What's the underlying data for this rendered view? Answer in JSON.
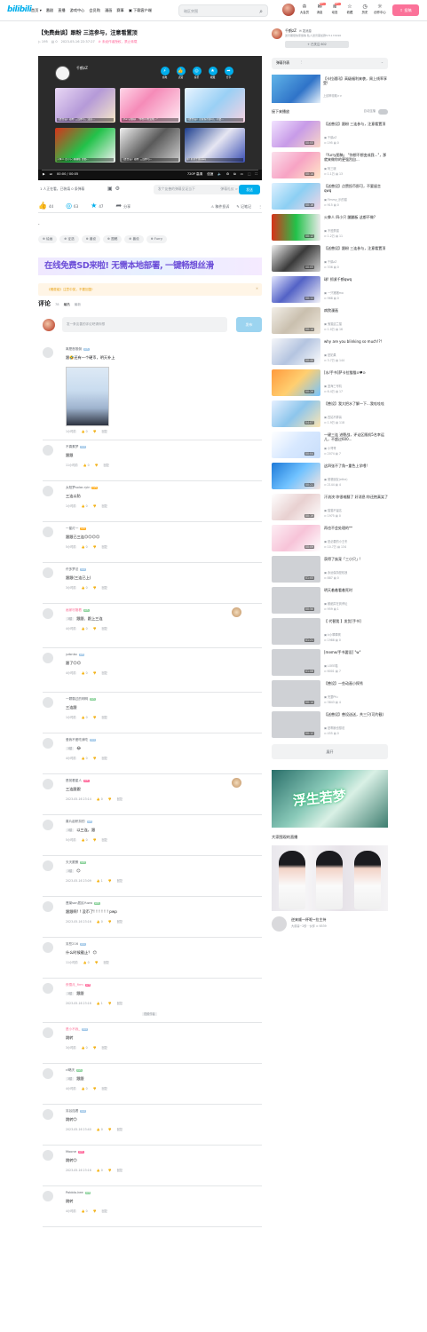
{
  "header": {
    "logo": "bilibili",
    "nav": [
      "首页 ▾",
      "番剧",
      "直播",
      "游戏中心",
      "会员购",
      "漫画",
      "赛事",
      "下载客户端"
    ],
    "search_placeholder": "暗区突围",
    "user_icons": [
      {
        "label": "大会员",
        "icon": "crown-icon",
        "badge": ""
      },
      {
        "label": "消息",
        "icon": "message-icon",
        "badge": "99+"
      },
      {
        "label": "动态",
        "icon": "wind-icon",
        "badge": "99+"
      },
      {
        "label": "收藏",
        "icon": "star-icon",
        "badge": ""
      },
      {
        "label": "历史",
        "icon": "clock-icon",
        "badge": ""
      },
      {
        "label": "创作中心",
        "icon": "bulb-icon",
        "badge": ""
      }
    ],
    "upload": "投稿"
  },
  "video": {
    "title": "【免费曲谈】跟粉 三连参与，注意看置顶",
    "views": "195",
    "danmaku": "0",
    "date": "2023-05-16 22:37:27",
    "warning": "⊘ 未经作者授权，禁止转载",
    "player": {
      "up_name": "千鹤zZ",
      "actions": [
        {
          "label": "充电",
          "icon": "battery-icon"
        },
        {
          "label": "点赞",
          "icon": "like-icon"
        },
        {
          "label": "投币",
          "icon": "coin-icon"
        },
        {
          "label": "收藏",
          "icon": "star-icon"
        },
        {
          "label": "分享",
          "icon": "share-icon"
        }
      ],
      "recs": [
        {
          "title": "【送兽设】跟粉 三连参与，注意...",
          "bg": "linear-gradient(135deg,#e9d8f5,#b59ad8 50%,#f6e8c8)"
        },
        {
          "title": "【furry图稿】 \"你想不想变成...\"",
          "bg": "linear-gradient(135deg,#ffd6e8,#f58bb8 40%,#ffe9f2)"
        },
        {
          "title": "【送兽设】点赞投币即可，不要...",
          "bg": "linear-gradient(135deg,#e8f4ff,#9ad0f5 50%,#f6d2e2)"
        },
        {
          "title": "火拳人 四小只 蹦蹦板 这都...",
          "bg": "linear-gradient(135deg,#d8321a,#22c24a 50%,#f2f2f2)"
        },
        {
          "title": "【送兽设】跟粉 三连参与...",
          "bg": "linear-gradient(135deg,#efefef,#5a5a5a 50%,#d0d0d0)"
        },
        {
          "title": "球! 抓紧千鹤qwq",
          "bg": "linear-gradient(135deg,#1e3f8f,#e6e6f2 50%,#3a4fb4)"
        }
      ],
      "time": "00:00 / 00:05",
      "quality": "720P 高清",
      "speed": "倍速",
      "progress": 0
    },
    "danmaku_bar": {
      "watching": "1 人正在看，已装填 0 条弹幕",
      "placeholder": "发个友善的弹幕见证当下",
      "etiquette": "弹幕礼仪 >",
      "send": "发送"
    },
    "toolbar": {
      "like": "44",
      "coin": "63",
      "fav": "47",
      "share": "分享",
      "report": "稿件投诉",
      "note": "记笔记"
    },
    "desc": "-",
    "tags": [
      "绘画",
      "征选",
      "兽设",
      "图稿",
      "兽设",
      "Furry"
    ]
  },
  "banner": "在线免费SD来啦! 无需本地部署, 一键畅想丝滑",
  "notice": "《稿费组》注意中奖，不要回复!",
  "comments_section": {
    "title": "评论",
    "count": "78",
    "sort_hot": "最热",
    "sort_new": "最新",
    "placeholder": "发一条友善的评论吧请你想",
    "post": "发布"
  },
  "comments": [
    {
      "name": "离是首推倒",
      "lv": "LV5",
      "lvc": "",
      "pink": false,
      "reply_to": "",
      "body": "跟🤣还有一个硬币，明天补上",
      "meta": [
        "1小时前",
        "0",
        "回复"
      ],
      "height": 110,
      "image": true,
      "label": ""
    },
    {
      "name": "不喜素梦",
      "lv": "LV4",
      "lvc": "",
      "pink": false,
      "reply_to": "",
      "body": "跟跟",
      "meta": [
        "11小时前",
        "0",
        "回复"
      ],
      "height": 46
    },
    {
      "name": "太阳梦solar-ryin",
      "lv": "LV5",
      "lvc": "o",
      "pink": false,
      "reply_to": "",
      "body": "三连以防",
      "meta": [
        "1小时前",
        "0",
        "回复"
      ],
      "height": 46
    },
    {
      "name": "一星灯一",
      "lv": "LV5",
      "lvc": "o",
      "pink": false,
      "reply_to": "",
      "body": "跟跟已三连😊😊😊😊",
      "meta": [
        "5小时前",
        "0",
        "回复"
      ],
      "height": 46
    },
    {
      "name": "许多梦法",
      "lv": "LV4",
      "lvc": "",
      "pink": false,
      "reply_to": "",
      "body": "跟跟(三连已上)",
      "meta": [
        "3小时前",
        "0",
        "回复"
      ],
      "height": 46
    },
    {
      "name": "画家尽管看",
      "lv": "LV5",
      "lvc": "g",
      "pink": true,
      "reply_to": "3楼",
      "body": "跟跟、跟上三连",
      "meta": [
        "4小时前",
        "0",
        "回复"
      ],
      "height": 50,
      "fan": true
    },
    {
      "name": "yzbnko",
      "lv": "LV5",
      "lvc": "",
      "pink": false,
      "reply_to": "",
      "body": "跟了😊😊",
      "meta": [
        "4小时前",
        "0",
        "回复"
      ],
      "height": 50
    },
    {
      "name": "一颗霸过的明明",
      "lv": "LV5",
      "lvc": "g",
      "pink": false,
      "reply_to": "",
      "body": "三连跟",
      "meta": [
        "1小时前",
        "0",
        "回复"
      ],
      "height": 46
    },
    {
      "name": "爱我不爱吃我吃",
      "lv": "LV4",
      "lvc": "",
      "pink": false,
      "reply_to": "3楼",
      "body": "😂",
      "meta": [
        "4小时前",
        "0",
        "回复"
      ],
      "height": 46
    },
    {
      "name": "是苑看星人",
      "lv": "LV5",
      "lvc": "r",
      "pink": false,
      "reply_to": "",
      "body": "三连跟跟",
      "meta": [
        "2023-05-16 23:14",
        "0",
        "回复"
      ],
      "height": 46,
      "fan": true
    },
    {
      "name": "喜片起积扣的",
      "lv": "LV4",
      "lvc": "",
      "pink": false,
      "reply_to": "3楼",
      "body": "以三连，跟",
      "meta": [
        "5小时前",
        "0",
        "回复"
      ],
      "height": 46
    },
    {
      "name": "天天跟蛋",
      "lv": "LV5",
      "lvc": "g",
      "pink": false,
      "reply_to": "3楼",
      "body": "😊",
      "meta": [
        "2023-05-16 23:09",
        "1",
        "回复"
      ],
      "height": 46
    },
    {
      "name": "蓬莱son居民Yuwo",
      "lv": "LV5",
      "lvc": "g",
      "pink": false,
      "reply_to": "",
      "body": "跟跟啊! ! 没币了! ! ! ! ! ! pwp",
      "meta": [
        "2023-05-16 23:16",
        "0",
        "回复"
      ],
      "height": 46
    },
    {
      "name": "另些216",
      "lv": "LV4",
      "lvc": "",
      "pink": false,
      "reply_to": "",
      "body": "什么时候截止？ 😊",
      "meta": [
        "11小时前",
        "0",
        "回复"
      ],
      "height": 46
    },
    {
      "name": "夜雪月_firm",
      "lv": "LV5",
      "lvc": "r",
      "pink": true,
      "reply_to": "3楼",
      "body": "跟跟",
      "meta": [
        "2023-05-16 23:16",
        "1",
        "回复"
      ],
      "height": 50,
      "label": "视频作者"
    },
    {
      "name": "是小不我_",
      "lv": "LV4",
      "lvc": "",
      "pink": true,
      "reply_to": "",
      "body": "跳转",
      "meta": [
        "3小时前",
        "0",
        "回复"
      ],
      "height": 46
    },
    {
      "name": "cl略天",
      "lv": "LV5",
      "lvc": "g",
      "pink": false,
      "reply_to": "3楼",
      "body": "跟跟",
      "meta": [
        "4小时前",
        "0",
        "回复"
      ],
      "height": 46
    },
    {
      "name": "另谷连看",
      "lv": "LV4",
      "lvc": "",
      "pink": false,
      "reply_to": "",
      "body": "跳转😊",
      "meta": [
        "2023-05-16 23:40",
        "0",
        "回复"
      ],
      "height": 46
    },
    {
      "name": "Moone",
      "lv": "LV5",
      "lvc": "r",
      "pink": false,
      "reply_to": "",
      "body": "跳转😊",
      "meta": [
        "2023-05-16 23:16",
        "0",
        "回复"
      ],
      "height": 46
    },
    {
      "name": "Pobblo-kee",
      "lv": "LV4",
      "lvc": "g",
      "pink": false,
      "reply_to": "",
      "body": "跳转",
      "meta": [
        "4小时前",
        "0",
        "回复"
      ],
      "height": 46
    }
  ],
  "sidebar": {
    "up": {
      "name": "千鹤zZ",
      "msg": "✉ 发消息",
      "desc": "送兽期很快家族等 私人送兽需加群571172996",
      "follow": "+ 已关注 602"
    },
    "danmaku_list": {
      "label": "弹幕列表",
      "more": "⋮",
      "arrow": "⌄"
    },
    "promo": {
      "title": "【卡拉通讯】高级福利来袭，周上线率享受!",
      "sub": "上线率领取>>"
    },
    "next_label": "接下来播放",
    "autoplay": "自动连播",
    "videos": [
      {
        "title": "【送兽设】跟粉 三连参与，注意看置顶",
        "up": "千鹤zZ",
        "stats": "⊙ 195  ▤ 0",
        "dur": "00:05",
        "bg": "linear-gradient(135deg,#f2e3ff,#c79be8 50%,#f9d7c7)"
      },
      {
        "title": "「furry图稿」 \"你想不想变成我...\"，那就来做你的更强烈自...",
        "up": "阿三啵",
        "stats": "⊙ 1.1万  ▤ 13",
        "dur": "00:14",
        "bg": "linear-gradient(135deg,#fbe0ec,#f7a3c4 50%,#ffe8c9)"
      },
      {
        "title": "【送兽设】点赞投币即可，不要留言qwq",
        "up": "Fimmy_乐的猫",
        "stats": "⊙ 915  ▤ 0",
        "dur": "00:16",
        "bg": "linear-gradient(135deg,#dff1ff,#8ccff3 50%,#f3d6e6)"
      },
      {
        "title": "火拳人 四小只 蹦蹦板 这都不做?",
        "up": "不遵禁猫",
        "stats": "⊙ 1.2万  ▤ 11",
        "dur": "00:12",
        "bg": "linear-gradient(90deg,#d8321a,#22c24a 50%,#eaeaea)"
      },
      {
        "title": "【送兽设】跟粉 三连参与，注意看置顶",
        "up": "千鹤zZ",
        "stats": "⊙ 336  ▤ 0",
        "dur": "00:05",
        "bg": "linear-gradient(135deg,#f0f0f0,#3a3a3a 50%,#cfcfcf)"
      },
      {
        "title": "球! 抓紧千鹤qwq",
        "up": "一只猪猪mo",
        "stats": "⊙ 968  ▤ 0",
        "dur": "00:11",
        "bg": "linear-gradient(135deg,#e4e7ff,#5362c6 45%,#f3f3f8)"
      },
      {
        "title": "病院漫画",
        "up": "鬼猫遗兰猫",
        "stats": "⊙ 1.0万  ▤ 16",
        "dur": "00:14",
        "bg": "linear-gradient(135deg,#f3efe8,#c9bfae 50%,#efe8dc)"
      },
      {
        "title": "why are you blinking so much!?!",
        "up": "是奶果",
        "stats": "⊙ 3.7万  ▤ 144",
        "dur": "00:44",
        "bg": "linear-gradient(135deg,#f5f6f9,#b4c4e0 50%,#fdfdfd)"
      },
      {
        "title": "[水/手书]萨卡拉猫猫⊙♥⊙",
        "up": "蓝海三号机",
        "stats": "⊙ 6.4万  ▤ 17",
        "dur": "00:29",
        "bg": "linear-gradient(135deg,#ff9a3d,#ffcf70 50%,#75c4ff)"
      },
      {
        "title": "【兽设】我大把水了解一下...我哇哇哇",
        "up": "四姑不胖兽",
        "stats": "⊙ 1.9万  ▤ 118",
        "dur": "04:07",
        "bg": "linear-gradient(135deg,#e6f0ff,#8dc5ec 50%,#fde6b3)"
      },
      {
        "title": "一键三连 进裂战，评论区随机5名幸运儿，不超过600...",
        "up": "小哥哥",
        "stats": "⊙ 2074  ▤ 7",
        "dur": "00:04",
        "bg": "linear-gradient(135deg,#ffffff,#d7e8ff 50%,#c9defa)"
      },
      {
        "title": "这四张不了角~重色上学喂!",
        "up": "爸爸朋友(ethe)",
        "stats": "⊙ 2144  ▤ 4",
        "dur": "00:21",
        "bg": "linear-gradient(135deg,#1e7ad8,#70c2ff 50%,#f8e6e0)"
      },
      {
        "title": "汗流浃:你很难翻了 好消息:你还抱真笑了",
        "up": "猫猫不留名",
        "stats": "⊙ 1975  ▤ 0",
        "dur": "00:19",
        "bg": "linear-gradient(135deg,#ffffff,#e8d0d0 50%,#ffffff)"
      },
      {
        "title": "再也不会处理的**",
        "up": "是必要的小王冬",
        "stats": "⊙ 10.7万  ▤ 134",
        "dur": "00:09",
        "bg": "linear-gradient(135deg,#fdeef4,#f7c3d8 50%,#fff)"
      },
      {
        "title": "获得了族宠「三小只」!",
        "up": "永远保持是较浪",
        "stats": "⊙ 887  ▤ 0",
        "dur": "01:05",
        "bg": "#cfd1d5"
      },
      {
        "title": "明天着着看着死时",
        "up": "都细并在到黄坛",
        "stats": "⊙ 959  ▤ 1",
        "dur": "00:50",
        "bg": "#cfd1d5"
      },
      {
        "title": "【 代替我 】发货[手书]",
        "up": "k小翠翠啊",
        "stats": "⊙ 1988  ▤ 0",
        "dur": "01:21",
        "bg": "#cfd1d5"
      },
      {
        "title": "[meme/手书要设] \"w\"",
        "up": "LOEE喵",
        "stats": "⊙ 6001  ▤ 7",
        "dur": "01:06",
        "bg": "#cfd1d5"
      },
      {
        "title": "【兽设】一些动画小探秀",
        "up": "完整Pfu",
        "stats": "⊙ 3843  ▤ 4",
        "dur": "00:14",
        "bg": "#cfd1d5"
      },
      {
        "title": "【送兽设】兽设送送，共三只(可约截)",
        "up": "是啊我也想说",
        "stats": "⊙ 455  ▤ 0",
        "dur": "00:12",
        "bg": "#cfd1d5"
      }
    ],
    "expand": "展开",
    "ad_text": "浮生若梦",
    "live_title": "大家围观的直播",
    "live": {
      "name": "逆来顺一杯呢~拉主持",
      "sub": "大叔兽~2秒 · 伙伴",
      "viewers": "⊙ 6539"
    }
  }
}
